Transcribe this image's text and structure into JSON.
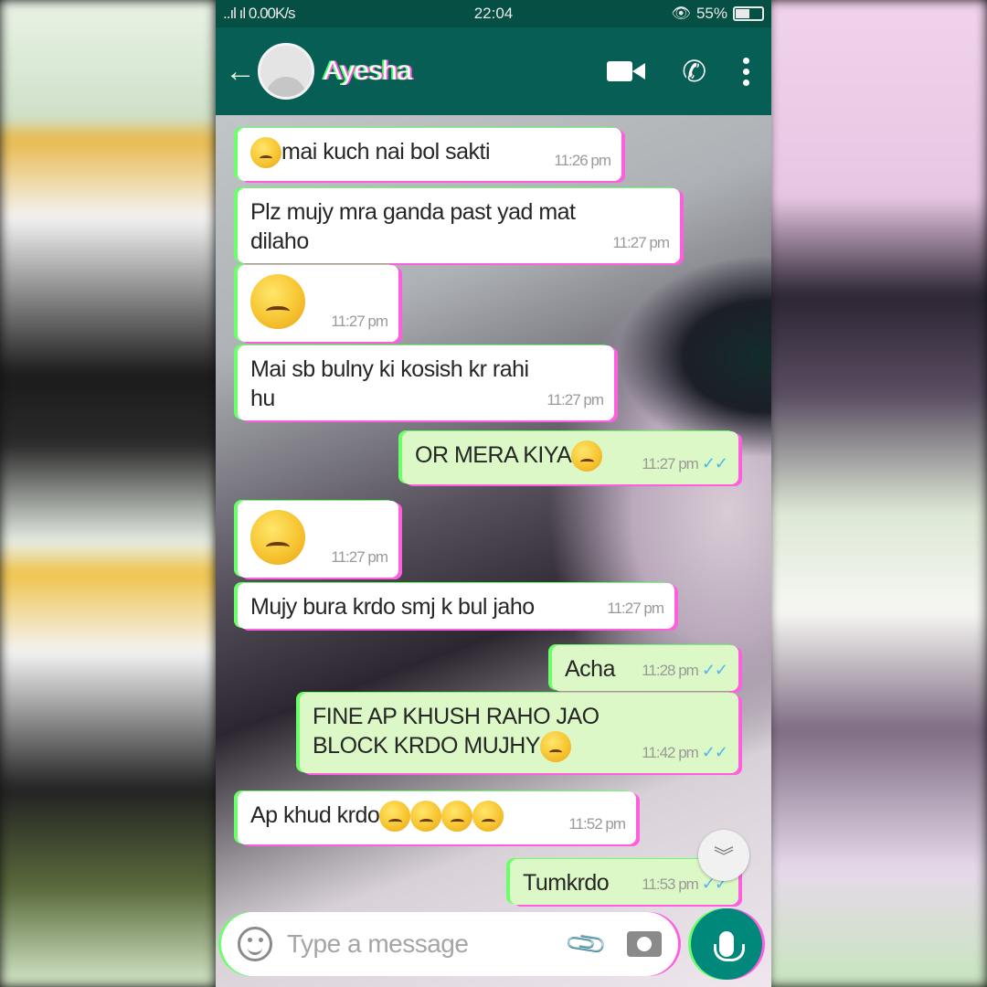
{
  "status_bar": {
    "left": "..ıl ıl 0.00K/s",
    "time": "22:04",
    "battery": "55%",
    "battery_level": 0.55
  },
  "header": {
    "contact_name": "Ayesha",
    "icons": [
      "back-arrow-icon",
      "avatar",
      "video-call-icon",
      "phone-call-icon",
      "more-options-icon"
    ]
  },
  "messages": [
    {
      "direction": "in",
      "text": "mai kuch nai bol sakti",
      "emoji": "weary-face",
      "emoji_position": "before",
      "time": "11:26 pm"
    },
    {
      "direction": "in",
      "text": "Plz mujy mra ganda past yad mat dilaho",
      "time": "11:27 pm"
    },
    {
      "direction": "in",
      "text": "",
      "emoji": "weary-face",
      "big": true,
      "time": "11:27 pm"
    },
    {
      "direction": "in",
      "text": "Mai sb bulny ki kosish kr rahi hu",
      "time": "11:27 pm"
    },
    {
      "direction": "out",
      "text": "OR MERA KIYA",
      "emoji": "relieved-face",
      "emoji_position": "after",
      "time": "11:27 pm",
      "ticks": "✓✓"
    },
    {
      "direction": "in",
      "text": "",
      "emoji": "weary-face",
      "big": true,
      "time": "11:27 pm"
    },
    {
      "direction": "in",
      "text": "Mujy bura krdo smj k bul jaho",
      "time": "11:27 pm"
    },
    {
      "direction": "out",
      "text": "Acha",
      "time": "11:28 pm",
      "ticks": "✓✓"
    },
    {
      "direction": "out",
      "text": "FINE AP KHUSH RAHO JAO BLOCK KRDO MUJHY",
      "emoji": "relieved-face",
      "emoji_position": "after",
      "time": "11:42 pm",
      "ticks": "✓✓"
    },
    {
      "direction": "in",
      "text": "Ap khud krdo",
      "emoji": "weary-face-x4",
      "emoji_position": "after",
      "time": "11:52 pm"
    },
    {
      "direction": "out",
      "text": "Tumkrdo",
      "time": "11:53 pm",
      "ticks": "✓✓"
    }
  ],
  "composer": {
    "placeholder": "Type a message",
    "icons": [
      "emoji-icon",
      "attach-icon",
      "camera-icon",
      "mic-icon"
    ]
  },
  "colors": {
    "header": "#075e54",
    "status_bar": "#054f44",
    "outgoing_bubble": "#dcf8c6",
    "incoming_bubble": "#ffffff",
    "mic_button": "#00897b",
    "read_ticks": "#4fb6ec"
  }
}
